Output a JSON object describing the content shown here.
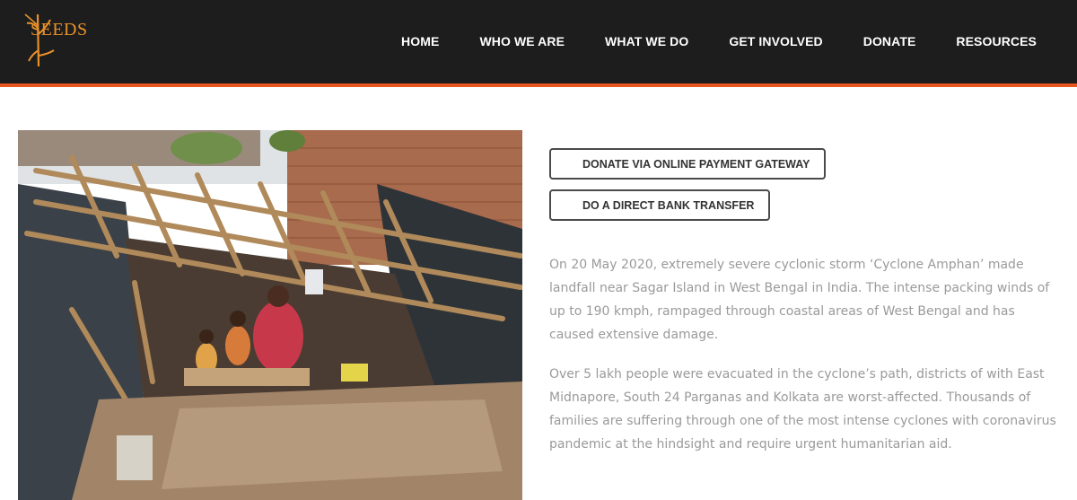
{
  "header": {
    "logo_text": "SEEDS",
    "nav": [
      {
        "label": "HOME"
      },
      {
        "label": "WHO WE ARE"
      },
      {
        "label": "WHAT WE DO"
      },
      {
        "label": "GET INVOLVED"
      },
      {
        "label": "DONATE"
      },
      {
        "label": "RESOURCES"
      }
    ]
  },
  "colors": {
    "header_bg": "#1d1d1d",
    "accent": "#e8561f",
    "body_text": "#9a9a9a"
  },
  "main": {
    "image_icon": "cyclone-damage-photo",
    "buttons": {
      "gateway": "DONATE VIA ONLINE PAYMENT GATEWAY",
      "bank": "DO A DIRECT BANK TRANSFER"
    },
    "paragraphs": [
      "On 20 May 2020, extremely severe cyclonic storm ‘Cyclone Amphan’ made landfall near Sagar Island in West Bengal in India. The intense packing winds of up to 190 kmph, rampaged through coastal areas of West Bengal and has caused extensive damage.",
      "Over 5 lakh people were evacuated in the cyclone’s path, districts of with East Midnapore, South 24 Parganas and Kolkata are worst-affected. Thousands of families are suffering through one of the most intense cyclones with coronavirus pandemic at the hindsight and require urgent humanitarian aid."
    ]
  }
}
